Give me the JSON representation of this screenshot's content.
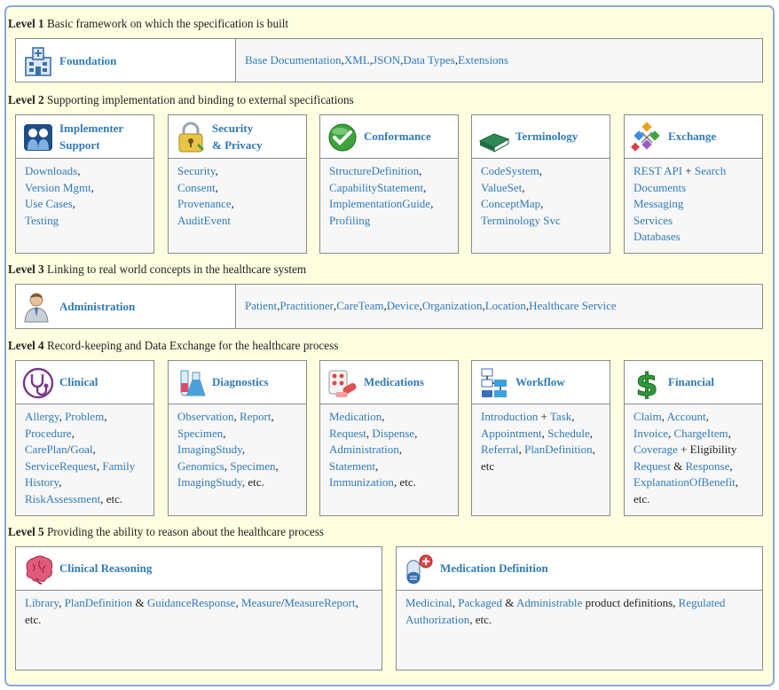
{
  "levels": [
    {
      "label": "Level 1",
      "desc": " Basic framework on which the specification is built"
    },
    {
      "label": "Level 2",
      "desc": " Supporting implementation and binding to external specifications"
    },
    {
      "label": "Level 3",
      "desc": " Linking to real world concepts in the healthcare system"
    },
    {
      "label": "Level 4",
      "desc": " Record-keeping and Data Exchange for the healthcare process"
    },
    {
      "label": "Level 5",
      "desc": " Providing the ability to reason about the healthcare process"
    }
  ],
  "foundation": {
    "title": "Foundation",
    "icon": "building-icon",
    "items": [
      [
        "Base Documentation",
        "l"
      ],
      [
        ", ",
        "t"
      ],
      [
        "XML",
        "l"
      ],
      [
        ", ",
        "t"
      ],
      [
        "JSON",
        "l"
      ],
      [
        ", ",
        "t"
      ],
      [
        "Data Types",
        "l"
      ],
      [
        ", ",
        "t"
      ],
      [
        "Extensions",
        "l"
      ]
    ]
  },
  "level2": [
    {
      "title": "Implementer Support",
      "title_lines": [
        "Implementer",
        "Support"
      ],
      "icon": "people-icon",
      "items": [
        [
          "Downloads",
          "l"
        ],
        [
          ",",
          "t"
        ],
        [
          "\n",
          "br"
        ],
        [
          "Version Mgmt",
          "l"
        ],
        [
          ",",
          "t"
        ],
        [
          "\n",
          "br"
        ],
        [
          "Use Cases",
          "l"
        ],
        [
          ",",
          "t"
        ],
        [
          "\n",
          "br"
        ],
        [
          "Testing",
          "l"
        ]
      ]
    },
    {
      "title": "Security & Privacy",
      "title_lines": [
        "Security",
        "& Privacy"
      ],
      "icon": "lock-icon",
      "items": [
        [
          "Security",
          "l"
        ],
        [
          ",",
          "t"
        ],
        [
          "\n",
          "br"
        ],
        [
          "Consent",
          "l"
        ],
        [
          ",",
          "t"
        ],
        [
          "\n",
          "br"
        ],
        [
          "Provenance",
          "l"
        ],
        [
          ",",
          "t"
        ],
        [
          "\n",
          "br"
        ],
        [
          "AuditEvent",
          "l"
        ]
      ]
    },
    {
      "title": "Conformance",
      "title_lines": [
        "Conformance"
      ],
      "icon": "check-icon",
      "items": [
        [
          "StructureDefinition",
          "l"
        ],
        [
          ",",
          "t"
        ],
        [
          "\n",
          "br"
        ],
        [
          "CapabilityStatement",
          "l"
        ],
        [
          ",",
          "t"
        ],
        [
          "\n",
          "br"
        ],
        [
          "ImplementationGuide",
          "l"
        ],
        [
          ",",
          "t"
        ],
        [
          "\n",
          "br"
        ],
        [
          "Profiling",
          "l"
        ]
      ]
    },
    {
      "title": "Terminology",
      "title_lines": [
        "Terminology"
      ],
      "icon": "book-icon",
      "items": [
        [
          "CodeSystem",
          "l"
        ],
        [
          ",",
          "t"
        ],
        [
          "\n",
          "br"
        ],
        [
          "ValueSet",
          "l"
        ],
        [
          ",",
          "t"
        ],
        [
          "\n",
          "br"
        ],
        [
          "ConceptMap",
          "l"
        ],
        [
          ",",
          "t"
        ],
        [
          "\n",
          "br"
        ],
        [
          "Terminology Svc",
          "l"
        ]
      ]
    },
    {
      "title": "Exchange",
      "title_lines": [
        "Exchange"
      ],
      "icon": "exchange-icon",
      "items": [
        [
          "REST API",
          "l"
        ],
        [
          " + ",
          "t"
        ],
        [
          "Search",
          "l"
        ],
        [
          "\n",
          "br"
        ],
        [
          "Documents",
          "l"
        ],
        [
          "\n",
          "br"
        ],
        [
          "Messaging",
          "l"
        ],
        [
          "\n",
          "br"
        ],
        [
          "Services",
          "l"
        ],
        [
          "\n",
          "br"
        ],
        [
          "Databases",
          "l"
        ]
      ]
    }
  ],
  "administration": {
    "title": "Administration",
    "icon": "person-icon",
    "items": [
      [
        "Patient",
        "l"
      ],
      [
        ", ",
        "t"
      ],
      [
        "Practitioner",
        "l"
      ],
      [
        ", ",
        "t"
      ],
      [
        "CareTeam",
        "l"
      ],
      [
        ", ",
        "t"
      ],
      [
        "Device",
        "l"
      ],
      [
        ", ",
        "t"
      ],
      [
        "Organization",
        "l"
      ],
      [
        ", ",
        "t"
      ],
      [
        "Location",
        "l"
      ],
      [
        ", ",
        "t"
      ],
      [
        "Healthcare Service",
        "l"
      ]
    ]
  },
  "level4": [
    {
      "title": "Clinical",
      "icon": "stethoscope-icon",
      "items": [
        [
          "Allergy",
          "l"
        ],
        [
          ", ",
          "t"
        ],
        [
          "Problem",
          "l"
        ],
        [
          ",",
          "t"
        ],
        [
          "\n",
          "br"
        ],
        [
          "Procedure",
          "l"
        ],
        [
          ",",
          "t"
        ],
        [
          "\n",
          "br"
        ],
        [
          "CarePlan",
          "l"
        ],
        [
          "/",
          "t"
        ],
        [
          "Goal",
          "l"
        ],
        [
          ",",
          "t"
        ],
        [
          "\n",
          "br"
        ],
        [
          "ServiceRequest",
          "l"
        ],
        [
          ", ",
          "t"
        ],
        [
          "Family History",
          "l"
        ],
        [
          ",",
          "t"
        ],
        [
          "\n",
          "br"
        ],
        [
          "RiskAssessment",
          "l"
        ],
        [
          ", etc.",
          "t"
        ]
      ]
    },
    {
      "title": "Diagnostics",
      "icon": "flask-icon",
      "items": [
        [
          "Observation",
          "l"
        ],
        [
          ", ",
          "t"
        ],
        [
          "Report",
          "l"
        ],
        [
          ",",
          "t"
        ],
        [
          "\n",
          "br"
        ],
        [
          "Specimen",
          "l"
        ],
        [
          ",",
          "t"
        ],
        [
          "\n",
          "br"
        ],
        [
          "ImagingStudy",
          "l"
        ],
        [
          ",",
          "t"
        ],
        [
          "\n",
          "br"
        ],
        [
          "Genomics",
          "l"
        ],
        [
          ", ",
          "t"
        ],
        [
          "Specimen",
          "l"
        ],
        [
          ",",
          "t"
        ],
        [
          "\n",
          "br"
        ],
        [
          "ImagingStudy",
          "l"
        ],
        [
          ", etc.",
          "t"
        ]
      ]
    },
    {
      "title": "Medications",
      "icon": "pills-icon",
      "items": [
        [
          "Medication",
          "l"
        ],
        [
          ",",
          "t"
        ],
        [
          "\n",
          "br"
        ],
        [
          "Request",
          "l"
        ],
        [
          ", ",
          "t"
        ],
        [
          "Dispense",
          "l"
        ],
        [
          ",",
          "t"
        ],
        [
          "\n",
          "br"
        ],
        [
          "Administration",
          "l"
        ],
        [
          ",",
          "t"
        ],
        [
          "\n",
          "br"
        ],
        [
          "Statement",
          "l"
        ],
        [
          ",",
          "t"
        ],
        [
          "\n",
          "br"
        ],
        [
          "Immunization",
          "l"
        ],
        [
          ", etc.",
          "t"
        ]
      ]
    },
    {
      "title": "Workflow",
      "icon": "workflow-icon",
      "items": [
        [
          "Introduction",
          "l"
        ],
        [
          " + ",
          "t"
        ],
        [
          "Task",
          "l"
        ],
        [
          ",",
          "t"
        ],
        [
          "\n",
          "br"
        ],
        [
          "Appointment",
          "l"
        ],
        [
          ", ",
          "t"
        ],
        [
          "Schedule",
          "l"
        ],
        [
          ",",
          "t"
        ],
        [
          "\n",
          "br"
        ],
        [
          "Referral",
          "l"
        ],
        [
          ", ",
          "t"
        ],
        [
          "PlanDefinition",
          "l"
        ],
        [
          ",",
          "t"
        ],
        [
          "\n",
          "br"
        ],
        [
          "etc",
          "t"
        ]
      ]
    },
    {
      "title": "Financial",
      "icon": "dollar-icon",
      "items": [
        [
          "Claim",
          "l"
        ],
        [
          ", ",
          "t"
        ],
        [
          "Account",
          "l"
        ],
        [
          ",",
          "t"
        ],
        [
          "\n",
          "br"
        ],
        [
          "Invoice",
          "l"
        ],
        [
          ", ",
          "t"
        ],
        [
          "ChargeItem",
          "l"
        ],
        [
          ",",
          "t"
        ],
        [
          "\n",
          "br"
        ],
        [
          "Coverage",
          "l"
        ],
        [
          " + Eligibility",
          "t"
        ],
        [
          "\n",
          "br"
        ],
        [
          "Request",
          "l"
        ],
        [
          " & ",
          "t"
        ],
        [
          "Response",
          "l"
        ],
        [
          ",",
          "t"
        ],
        [
          "\n",
          "br"
        ],
        [
          "ExplanationOfBenefit",
          "l"
        ],
        [
          ",",
          "t"
        ],
        [
          "\n",
          "br"
        ],
        [
          "etc.",
          "t"
        ]
      ]
    }
  ],
  "level5": [
    {
      "title": "Clinical Reasoning",
      "icon": "brain-icon",
      "items": [
        [
          "Library",
          "l"
        ],
        [
          ", ",
          "t"
        ],
        [
          "PlanDefinition",
          "l"
        ],
        [
          " & ",
          "t"
        ],
        [
          "GuidanceResponse",
          "l"
        ],
        [
          ", ",
          "t"
        ],
        [
          "Measure",
          "l"
        ],
        [
          "/",
          "t"
        ],
        [
          "MeasureReport",
          "l"
        ],
        [
          ",",
          "t"
        ],
        [
          "\n",
          "br"
        ],
        [
          "etc.",
          "t"
        ]
      ]
    },
    {
      "title": "Medication Definition",
      "icon": "capsule-icon",
      "items": [
        [
          "Medicinal",
          "l"
        ],
        [
          ", ",
          "t"
        ],
        [
          "Packaged",
          "l"
        ],
        [
          " & ",
          "t"
        ],
        [
          "Administrable",
          "l"
        ],
        [
          " product definitions, ",
          "t"
        ],
        [
          "Regulated",
          "l"
        ],
        [
          "\n",
          "br"
        ],
        [
          "Authorization",
          "l"
        ],
        [
          ", etc.",
          "t"
        ]
      ]
    }
  ]
}
